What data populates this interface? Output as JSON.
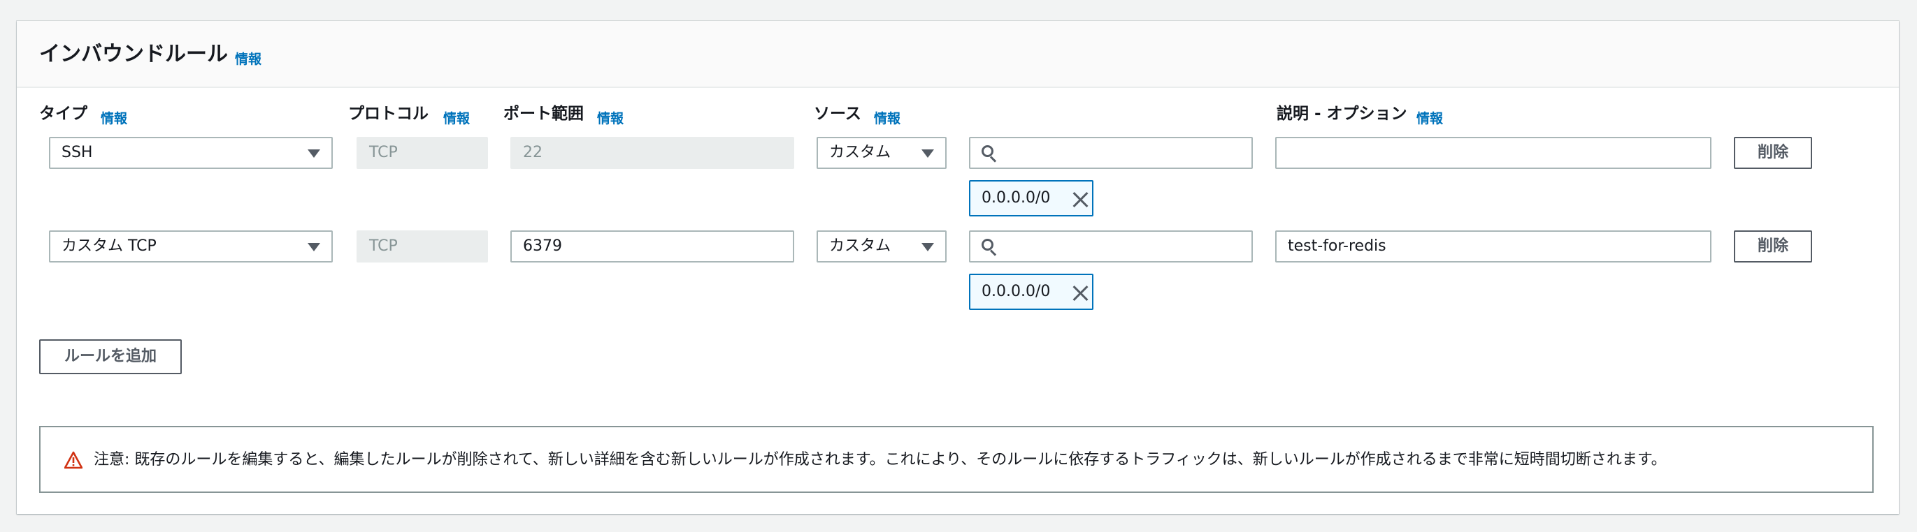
{
  "header": {
    "title": "インバウンドルール",
    "info": "情報"
  },
  "columns": {
    "type": {
      "label": "タイプ",
      "info": "情報"
    },
    "protocol": {
      "label": "プロトコル",
      "info": "情報"
    },
    "port_range": {
      "label": "ポート範囲",
      "info": "情報"
    },
    "source": {
      "label": "ソース",
      "info": "情報"
    },
    "description": {
      "label": "説明 - オプション",
      "info": "情報"
    }
  },
  "rules": [
    {
      "type": "SSH",
      "protocol": "TCP",
      "port_range": "22",
      "source_type": "カスタム",
      "source_search": "",
      "source_token": "0.0.0.0/0",
      "description": "",
      "delete_label": "削除"
    },
    {
      "type": "カスタム TCP",
      "protocol": "TCP",
      "port_range": "6379",
      "source_type": "カスタム",
      "source_search": "",
      "source_token": "0.0.0.0/0",
      "description": "test-for-redis",
      "delete_label": "削除"
    }
  ],
  "add_rule_label": "ルールを追加",
  "alert": {
    "text": "注意: 既存のルールを編集すると、編集したルールが削除されて、新しい詳細を含む新しいルールが作成されます。これにより、そのルールに依存するトラフィックは、新しいルールが作成されるまで非常に短時間切断されます。",
    "icon": "warning-icon",
    "icon_color": "#d13212"
  },
  "colors": {
    "link": "#0073bb",
    "token_border": "#0073bb",
    "token_bg": "#f1faff"
  }
}
